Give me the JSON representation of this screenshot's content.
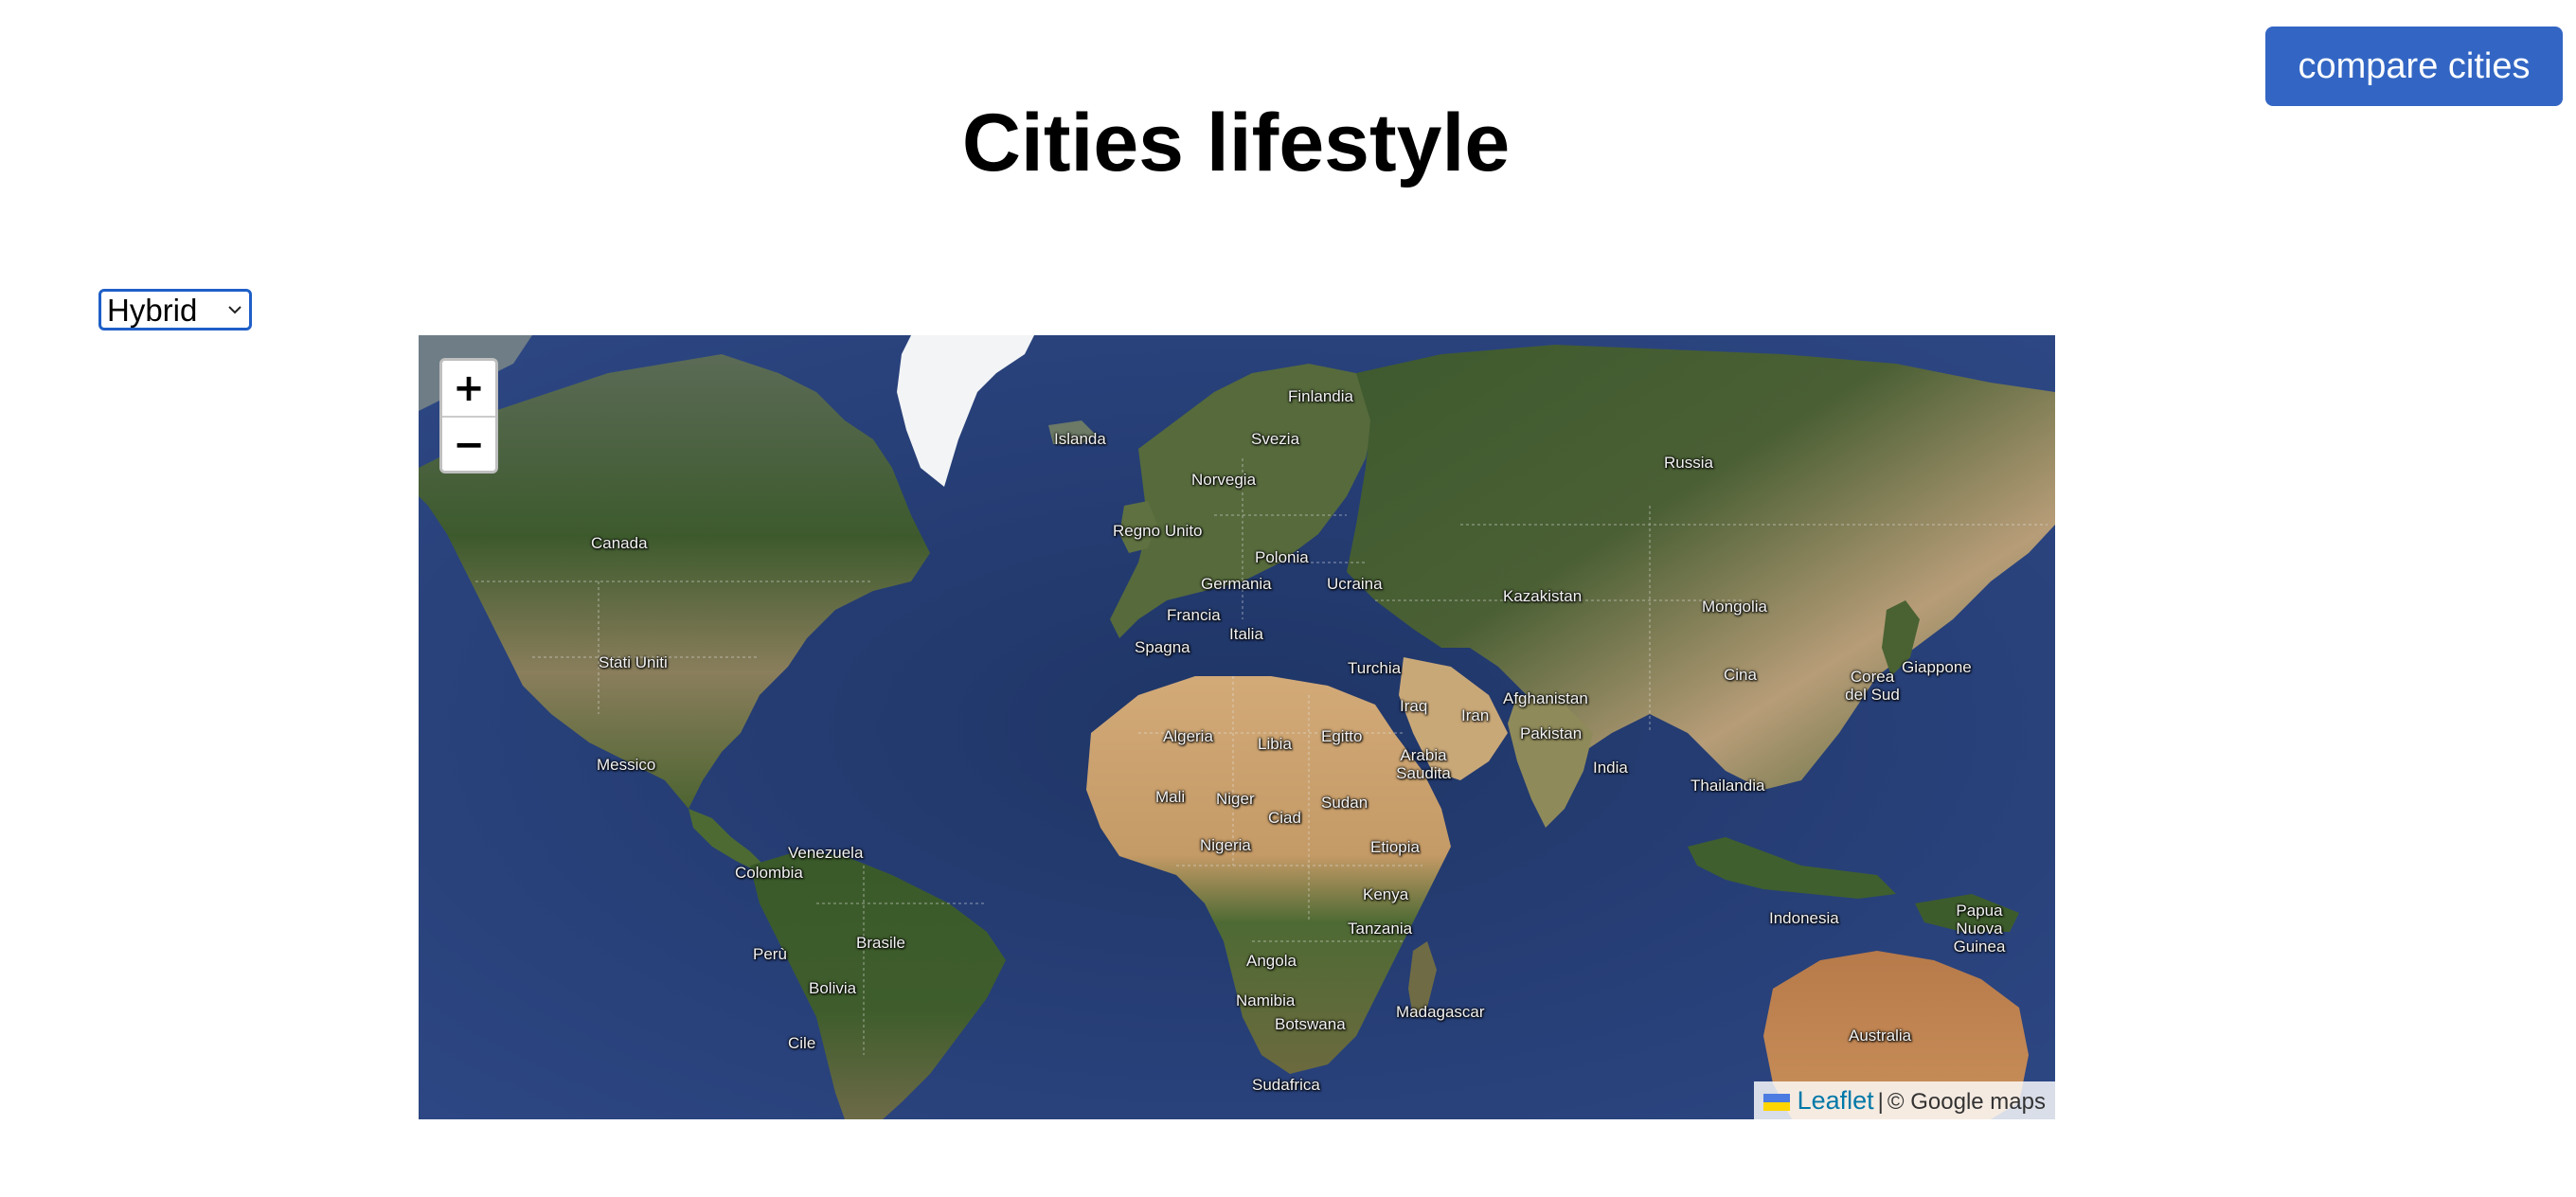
{
  "header": {
    "compare_button_label": "compare cities",
    "title": "Cities lifestyle"
  },
  "layer_select": {
    "selected": "Hybrid"
  },
  "map": {
    "zoom_in_label": "+",
    "zoom_out_label": "−",
    "attribution": {
      "leaflet_link": "Leaflet",
      "separator": "|",
      "provider": "© Google maps"
    },
    "colors": {
      "ocean": "#243a6e",
      "forest": "#3f5a2f",
      "desert": "#c9a070",
      "ice": "#f2f4f6",
      "attribution_link": "#0078a8"
    },
    "labels": {
      "islanda": "Islanda",
      "finlandia": "Finlandia",
      "svezia": "Svezia",
      "norvegia": "Norvegia",
      "russia": "Russia",
      "regno_unito": "Regno Unito",
      "polonia": "Polonia",
      "canada": "Canada",
      "germania": "Germania",
      "ucraina": "Ucraina",
      "kazakistan": "Kazakistan",
      "francia": "Francia",
      "mongolia": "Mongolia",
      "italia": "Italia",
      "spagna": "Spagna",
      "stati_uniti": "Stati Uniti",
      "turchia": "Turchia",
      "cina": "Cina",
      "corea_del_sud": "Corea del Sud",
      "giappone": "Giappone",
      "afghanistan": "Afghanistan",
      "iraq": "Iraq",
      "iran": "Iran",
      "pakistan": "Pakistan",
      "algeria": "Algeria",
      "libia": "Libia",
      "egitto": "Egitto",
      "arabia_saudita": "Arabia Saudita",
      "messico": "Messico",
      "india": "India",
      "thailandia": "Thailandia",
      "mali": "Mali",
      "niger": "Niger",
      "sudan": "Sudan",
      "ciad": "Ciad",
      "venezuela": "Venezuela",
      "nigeria": "Nigeria",
      "etiopia": "Etiopia",
      "colombia": "Colombia",
      "kenya": "Kenya",
      "brasile": "Brasile",
      "tanzania": "Tanzania",
      "indonesia": "Indonesia",
      "papua_nuova_guinea": "Papua Nuova Guinea",
      "peru": "Perù",
      "angola": "Angola",
      "bolivia": "Bolivia",
      "namibia": "Namibia",
      "madagascar": "Madagascar",
      "botswana": "Botswana",
      "australia": "Australia",
      "cile": "Cile",
      "sudafrica": "Sudafrica"
    }
  }
}
